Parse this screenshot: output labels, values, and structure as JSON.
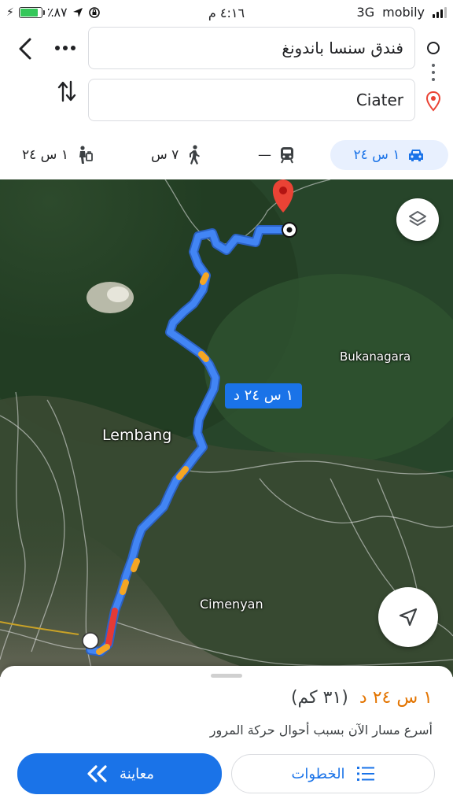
{
  "status_bar": {
    "battery_percent": "٪٨٧",
    "battery_level": 0.87,
    "time": "٤:١٦ م",
    "network": "3G",
    "carrier": "mobily"
  },
  "route": {
    "origin": "فندق سنسا باندونغ",
    "destination": "Ciater"
  },
  "modes": [
    {
      "name": "drive",
      "label": "١ س ٢٤",
      "selected": true
    },
    {
      "name": "transit",
      "label": "—"
    },
    {
      "name": "walk",
      "label": "٧ س"
    },
    {
      "name": "ride",
      "label": "١ س ٢٤"
    }
  ],
  "map": {
    "place_labels": [
      "Bukanagara",
      "Lembang",
      "Cimenyan"
    ],
    "duration_callout": "١ س ٢٤ د",
    "route_color": "#4285f4",
    "slow_color": "#f5a623",
    "jam_color": "#e53935",
    "destination_pin_color": "#ea4335"
  },
  "sheet": {
    "duration": "١ س ٢٤ د",
    "distance": "(٣١ كم)",
    "description": "أسرع مسار الآن بسبب أحوال حركة المرور",
    "steps_label": "الخطوات",
    "preview_label": "معاينة",
    "accent": "#1a73e8",
    "duration_color": "#e37400"
  }
}
